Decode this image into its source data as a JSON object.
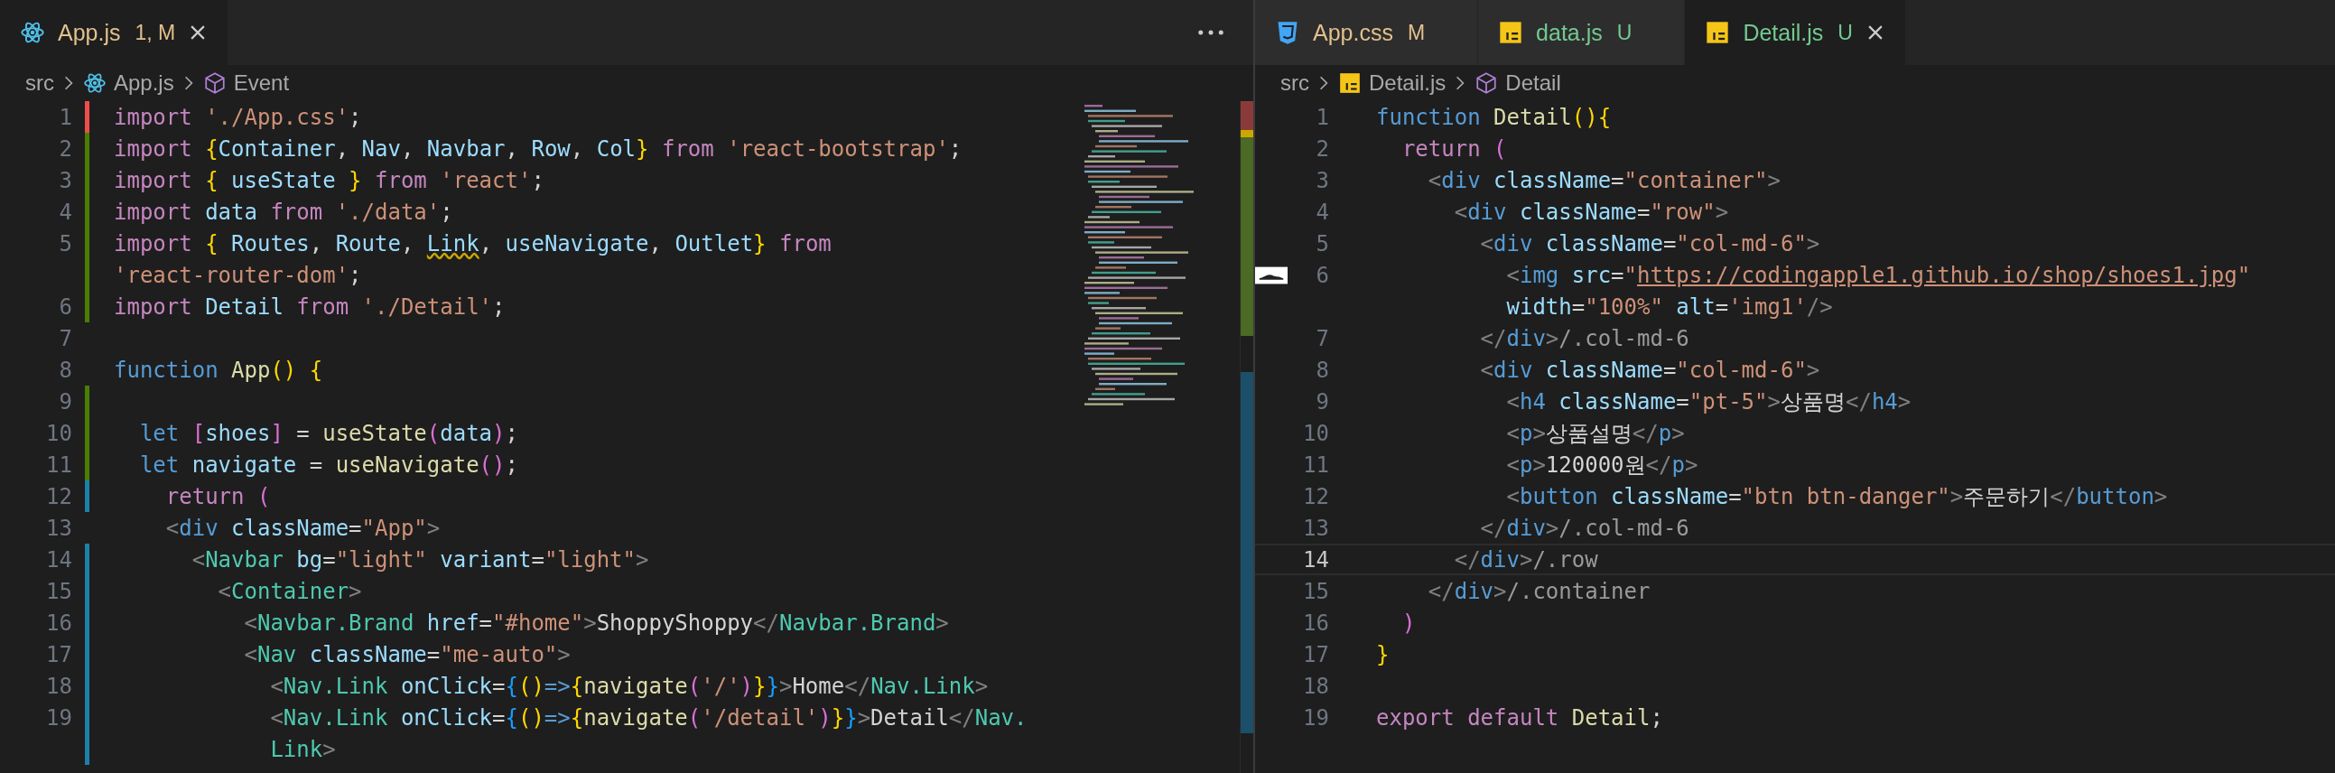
{
  "panes": [
    {
      "actions_menu": true,
      "minimap": true,
      "tabs": [
        {
          "label": "App.js",
          "badge": "1, M",
          "kind": "component",
          "color": "#e2c08d",
          "selected": true
        }
      ],
      "breadcrumb": [
        {
          "label": "src",
          "kind": "folder"
        },
        {
          "label": "App.js",
          "kind": "component"
        },
        {
          "label": "Event",
          "kind": "symbol"
        }
      ],
      "lines": [
        {
          "number": "1",
          "color": "#f14c4c",
          "tokens": [
            {
              "kind": "kw",
              "text": "import "
            },
            {
              "kind": "str",
              "text": "'./App.css'"
            },
            {
              "kind": "text",
              "text": ";"
            }
          ]
        },
        {
          "number": "2",
          "color": "#487e02",
          "tokens": [
            {
              "kind": "kw",
              "text": "import "
            },
            {
              "kind": "gold",
              "text": "{"
            },
            {
              "kind": "var",
              "text": "Container"
            },
            {
              "kind": "text",
              "text": ", "
            },
            {
              "kind": "var",
              "text": "Nav"
            },
            {
              "kind": "text",
              "text": ", "
            },
            {
              "kind": "var",
              "text": "Navbar"
            },
            {
              "kind": "text",
              "text": ", "
            },
            {
              "kind": "var",
              "text": "Row"
            },
            {
              "kind": "text",
              "text": ", "
            },
            {
              "kind": "var",
              "text": "Col"
            },
            {
              "kind": "gold",
              "text": "}"
            },
            {
              "kind": "kw",
              "text": " from "
            },
            {
              "kind": "str",
              "text": "'react-bootstrap'"
            },
            {
              "kind": "text",
              "text": ";"
            }
          ]
        },
        {
          "number": "3",
          "color": "#487e02",
          "tokens": [
            {
              "kind": "kw",
              "text": "import "
            },
            {
              "kind": "gold",
              "text": "{ "
            },
            {
              "kind": "var",
              "text": "useState"
            },
            {
              "kind": "gold",
              "text": " }"
            },
            {
              "kind": "kw",
              "text": " from "
            },
            {
              "kind": "str",
              "text": "'react'"
            },
            {
              "kind": "text",
              "text": ";"
            }
          ]
        },
        {
          "number": "4",
          "color": "#487e02",
          "tokens": [
            {
              "kind": "kw",
              "text": "import "
            },
            {
              "kind": "var",
              "text": "data"
            },
            {
              "kind": "kw",
              "text": " from "
            },
            {
              "kind": "str",
              "text": "'./data'"
            },
            {
              "kind": "text",
              "text": ";"
            }
          ]
        },
        {
          "number": "5",
          "color": "#487e02",
          "tokens": [
            {
              "kind": "kw",
              "text": "import "
            },
            {
              "kind": "gold",
              "text": "{ "
            },
            {
              "kind": "var",
              "text": "Routes"
            },
            {
              "kind": "text",
              "text": ", "
            },
            {
              "kind": "var",
              "text": "Route"
            },
            {
              "kind": "text",
              "text": ", "
            },
            {
              "kind": "var",
              "text": "Link",
              "warning": true
            },
            {
              "kind": "text",
              "text": ", "
            },
            {
              "kind": "var",
              "text": "useNavigate"
            },
            {
              "kind": "text",
              "text": ", "
            },
            {
              "kind": "var",
              "text": "Outlet"
            },
            {
              "kind": "gold",
              "text": "}"
            },
            {
              "kind": "kw",
              "text": " from"
            }
          ]
        },
        {
          "color": "#487e02",
          "tokens": [
            {
              "kind": "str",
              "text": "'react-router-dom'"
            },
            {
              "kind": "text",
              "text": ";"
            }
          ]
        },
        {
          "number": "6",
          "color": "#487e02",
          "tokens": [
            {
              "kind": "kw",
              "text": "import "
            },
            {
              "kind": "var",
              "text": "Detail"
            },
            {
              "kind": "kw",
              "text": " from "
            },
            {
              "kind": "str",
              "text": "'./Detail'"
            },
            {
              "kind": "text",
              "text": ";"
            }
          ]
        },
        {
          "number": "7"
        },
        {
          "number": "8",
          "tokens": [
            {
              "kind": "storage",
              "text": "function "
            },
            {
              "kind": "fn",
              "text": "App"
            },
            {
              "kind": "gold",
              "text": "() {"
            }
          ]
        },
        {
          "number": "9",
          "color": "#487e02"
        },
        {
          "number": "10",
          "color": "#487e02",
          "tokens": [
            {
              "kind": "storage",
              "text": "  let "
            },
            {
              "kind": "pink",
              "text": "["
            },
            {
              "kind": "var",
              "text": "shoes"
            },
            {
              "kind": "pink",
              "text": "]"
            },
            {
              "kind": "text",
              "text": " = "
            },
            {
              "kind": "fn",
              "text": "useState"
            },
            {
              "kind": "pink",
              "text": "("
            },
            {
              "kind": "var",
              "text": "data"
            },
            {
              "kind": "pink",
              "text": ")"
            },
            {
              "kind": "text",
              "text": ";"
            }
          ]
        },
        {
          "number": "11",
          "color": "#487e02",
          "tokens": [
            {
              "kind": "storage",
              "text": "  let "
            },
            {
              "kind": "var",
              "text": "navigate"
            },
            {
              "kind": "text",
              "text": " = "
            },
            {
              "kind": "fn",
              "text": "useNavigate"
            },
            {
              "kind": "pink",
              "text": "()"
            },
            {
              "kind": "text",
              "text": ";"
            }
          ]
        },
        {
          "number": "12",
          "color": "#1b81a8",
          "tokens": [
            {
              "kind": "kw",
              "text": "    return "
            },
            {
              "kind": "pink",
              "text": "("
            }
          ]
        },
        {
          "number": "13",
          "tokens": [
            {
              "kind": "angle",
              "text": "    <"
            },
            {
              "kind": "tag",
              "text": "div"
            },
            {
              "kind": "var",
              "text": " className"
            },
            {
              "kind": "text",
              "text": "="
            },
            {
              "kind": "str",
              "text": "\"App\""
            },
            {
              "kind": "angle",
              "text": ">"
            }
          ]
        },
        {
          "number": "14",
          "color": "#1b81a8",
          "tokens": [
            {
              "kind": "angle",
              "text": "      <"
            },
            {
              "kind": "comp",
              "text": "Navbar"
            },
            {
              "kind": "var",
              "text": " bg"
            },
            {
              "kind": "text",
              "text": "="
            },
            {
              "kind": "str",
              "text": "\"light\""
            },
            {
              "kind": "var",
              "text": " variant"
            },
            {
              "kind": "text",
              "text": "="
            },
            {
              "kind": "str",
              "text": "\"light\""
            },
            {
              "kind": "angle",
              "text": ">"
            }
          ]
        },
        {
          "number": "15",
          "color": "#1b81a8",
          "tokens": [
            {
              "kind": "angle",
              "text": "        <"
            },
            {
              "kind": "comp",
              "text": "Container"
            },
            {
              "kind": "angle",
              "text": ">"
            }
          ]
        },
        {
          "number": "16",
          "color": "#1b81a8",
          "tokens": [
            {
              "kind": "angle",
              "text": "          <"
            },
            {
              "kind": "comp",
              "text": "Navbar.Brand"
            },
            {
              "kind": "var",
              "text": " href"
            },
            {
              "kind": "text",
              "text": "="
            },
            {
              "kind": "str",
              "text": "\"#home\""
            },
            {
              "kind": "angle",
              "text": ">"
            },
            {
              "kind": "text",
              "text": "ShoppyShoppy"
            },
            {
              "kind": "angle",
              "text": "</"
            },
            {
              "kind": "comp",
              "text": "Navbar.Brand"
            },
            {
              "kind": "angle",
              "text": ">"
            }
          ]
        },
        {
          "number": "17",
          "color": "#1b81a8",
          "tokens": [
            {
              "kind": "angle",
              "text": "          <"
            },
            {
              "kind": "comp",
              "text": "Nav"
            },
            {
              "kind": "var",
              "text": " className"
            },
            {
              "kind": "text",
              "text": "="
            },
            {
              "kind": "str",
              "text": "\"me-auto\""
            },
            {
              "kind": "angle",
              "text": ">"
            }
          ]
        },
        {
          "number": "18",
          "color": "#1b81a8",
          "tokens": [
            {
              "kind": "angle",
              "text": "            <"
            },
            {
              "kind": "comp",
              "text": "Nav.Link"
            },
            {
              "kind": "var",
              "text": " onClick"
            },
            {
              "kind": "text",
              "text": "="
            },
            {
              "kind": "blue",
              "text": "{"
            },
            {
              "kind": "gold",
              "text": "()"
            },
            {
              "kind": "storage",
              "text": "=>"
            },
            {
              "kind": "gold",
              "text": "{"
            },
            {
              "kind": "fn",
              "text": "navigate"
            },
            {
              "kind": "pink",
              "text": "("
            },
            {
              "kind": "str",
              "text": "'/'"
            },
            {
              "kind": "pink",
              "text": ")"
            },
            {
              "kind": "gold",
              "text": "}"
            },
            {
              "kind": "blue",
              "text": "}"
            },
            {
              "kind": "angle",
              "text": ">"
            },
            {
              "kind": "text",
              "text": "Home"
            },
            {
              "kind": "angle",
              "text": "</"
            },
            {
              "kind": "comp",
              "text": "Nav.Link"
            },
            {
              "kind": "angle",
              "text": ">"
            }
          ]
        },
        {
          "number": "19",
          "color": "#1b81a8",
          "tokens": [
            {
              "kind": "angle",
              "text": "            <"
            },
            {
              "kind": "comp",
              "text": "Nav.Link"
            },
            {
              "kind": "var",
              "text": " onClick"
            },
            {
              "kind": "text",
              "text": "="
            },
            {
              "kind": "blue",
              "text": "{"
            },
            {
              "kind": "gold",
              "text": "()"
            },
            {
              "kind": "storage",
              "text": "=>"
            },
            {
              "kind": "gold",
              "text": "{"
            },
            {
              "kind": "fn",
              "text": "navigate"
            },
            {
              "kind": "pink",
              "text": "("
            },
            {
              "kind": "str",
              "text": "'/detail'"
            },
            {
              "kind": "pink",
              "text": ")"
            },
            {
              "kind": "gold",
              "text": "}"
            },
            {
              "kind": "blue",
              "text": "}"
            },
            {
              "kind": "angle",
              "text": ">"
            },
            {
              "kind": "text",
              "text": "Detail"
            },
            {
              "kind": "angle",
              "text": "</"
            },
            {
              "kind": "comp",
              "text": "Nav."
            }
          ]
        },
        {
          "color": "#1b81a8",
          "tokens": [
            {
              "kind": "comp",
              "text": "            Link"
            },
            {
              "kind": "angle",
              "text": ">"
            }
          ]
        }
      ]
    },
    {
      "tabs": [
        {
          "label": "App.css",
          "badge": "M",
          "kind": "stylesheet",
          "color": "#e2c08d",
          "selected": false
        },
        {
          "label": "data.js",
          "badge": "U",
          "kind": "script",
          "color": "#73c991",
          "selected": false
        },
        {
          "label": "Detail.js",
          "badge": "U",
          "kind": "script",
          "color": "#73c991",
          "selected": true
        }
      ],
      "breadcrumb": [
        {
          "label": "src",
          "kind": "folder"
        },
        {
          "label": "Detail.js",
          "kind": "script"
        },
        {
          "label": "Detail",
          "kind": "symbol"
        }
      ],
      "lines": [
        {
          "number": "1",
          "tokens": [
            {
              "kind": "storage",
              "text": "function "
            },
            {
              "kind": "fn",
              "text": "Detail"
            },
            {
              "kind": "gold",
              "text": "(){"
            }
          ]
        },
        {
          "number": "2",
          "tokens": [
            {
              "kind": "kw",
              "text": "  return "
            },
            {
              "kind": "pink",
              "text": "("
            }
          ]
        },
        {
          "number": "3",
          "tokens": [
            {
              "kind": "angle",
              "text": "    <"
            },
            {
              "kind": "tag",
              "text": "div"
            },
            {
              "kind": "var",
              "text": " className"
            },
            {
              "kind": "text",
              "text": "="
            },
            {
              "kind": "str",
              "text": "\"container\""
            },
            {
              "kind": "angle",
              "text": ">"
            }
          ]
        },
        {
          "number": "4",
          "tokens": [
            {
              "kind": "angle",
              "text": "      <"
            },
            {
              "kind": "tag",
              "text": "div"
            },
            {
              "kind": "var",
              "text": " className"
            },
            {
              "kind": "text",
              "text": "="
            },
            {
              "kind": "str",
              "text": "\"row\""
            },
            {
              "kind": "angle",
              "text": ">"
            }
          ]
        },
        {
          "number": "5",
          "tokens": [
            {
              "kind": "angle",
              "text": "        <"
            },
            {
              "kind": "tag",
              "text": "div"
            },
            {
              "kind": "var",
              "text": " className"
            },
            {
              "kind": "text",
              "text": "="
            },
            {
              "kind": "str",
              "text": "\"col-md-6\""
            },
            {
              "kind": "angle",
              "text": ">"
            }
          ]
        },
        {
          "number": "6",
          "preview": true,
          "tokens": [
            {
              "kind": "angle",
              "text": "          <"
            },
            {
              "kind": "tag",
              "text": "img"
            },
            {
              "kind": "var",
              "text": " src"
            },
            {
              "kind": "text",
              "text": "="
            },
            {
              "kind": "str",
              "text": "\""
            },
            {
              "kind": "url",
              "text": "https://codingapple1.github.io/shop/shoes1.jpg"
            },
            {
              "kind": "str",
              "text": "\""
            }
          ]
        },
        {
          "tokens": [
            {
              "kind": "var",
              "text": "          width"
            },
            {
              "kind": "text",
              "text": "="
            },
            {
              "kind": "str",
              "text": "\"100%\""
            },
            {
              "kind": "var",
              "text": " alt"
            },
            {
              "kind": "text",
              "text": "="
            },
            {
              "kind": "str",
              "text": "'img1'"
            },
            {
              "kind": "angle",
              "text": "/>"
            }
          ]
        },
        {
          "number": "7",
          "tokens": [
            {
              "kind": "angle",
              "text": "        </"
            },
            {
              "kind": "tag",
              "text": "div"
            },
            {
              "kind": "angle",
              "text": ">"
            },
            {
              "kind": "hint",
              "text": "/.col-md-6"
            }
          ]
        },
        {
          "number": "8",
          "tokens": [
            {
              "kind": "angle",
              "text": "        <"
            },
            {
              "kind": "tag",
              "text": "div"
            },
            {
              "kind": "var",
              "text": " className"
            },
            {
              "kind": "text",
              "text": "="
            },
            {
              "kind": "str",
              "text": "\"col-md-6\""
            },
            {
              "kind": "angle",
              "text": ">"
            }
          ]
        },
        {
          "number": "9",
          "tokens": [
            {
              "kind": "angle",
              "text": "          <"
            },
            {
              "kind": "tag",
              "text": "h4"
            },
            {
              "kind": "var",
              "text": " className"
            },
            {
              "kind": "text",
              "text": "="
            },
            {
              "kind": "str",
              "text": "\"pt-5\""
            },
            {
              "kind": "angle",
              "text": ">"
            },
            {
              "kind": "text",
              "text": "상품명"
            },
            {
              "kind": "angle",
              "text": "</"
            },
            {
              "kind": "tag",
              "text": "h4"
            },
            {
              "kind": "angle",
              "text": ">"
            }
          ]
        },
        {
          "number": "10",
          "tokens": [
            {
              "kind": "angle",
              "text": "          <"
            },
            {
              "kind": "tag",
              "text": "p"
            },
            {
              "kind": "angle",
              "text": ">"
            },
            {
              "kind": "text",
              "text": "상품설명"
            },
            {
              "kind": "angle",
              "text": "</"
            },
            {
              "kind": "tag",
              "text": "p"
            },
            {
              "kind": "angle",
              "text": ">"
            }
          ]
        },
        {
          "number": "11",
          "tokens": [
            {
              "kind": "angle",
              "text": "          <"
            },
            {
              "kind": "tag",
              "text": "p"
            },
            {
              "kind": "angle",
              "text": ">"
            },
            {
              "kind": "text",
              "text": "120000원"
            },
            {
              "kind": "angle",
              "text": "</"
            },
            {
              "kind": "tag",
              "text": "p"
            },
            {
              "kind": "angle",
              "text": ">"
            }
          ]
        },
        {
          "number": "12",
          "tokens": [
            {
              "kind": "angle",
              "text": "          <"
            },
            {
              "kind": "tag",
              "text": "button"
            },
            {
              "kind": "var",
              "text": " className"
            },
            {
              "kind": "text",
              "text": "="
            },
            {
              "kind": "str",
              "text": "\"btn btn-danger\""
            },
            {
              "kind": "angle",
              "text": ">"
            },
            {
              "kind": "text",
              "text": "주문하기"
            },
            {
              "kind": "angle",
              "text": "</"
            },
            {
              "kind": "tag",
              "text": "button"
            },
            {
              "kind": "angle",
              "text": ">"
            }
          ]
        },
        {
          "number": "13",
          "tokens": [
            {
              "kind": "angle",
              "text": "        </"
            },
            {
              "kind": "tag",
              "text": "div"
            },
            {
              "kind": "angle",
              "text": ">"
            },
            {
              "kind": "hint",
              "text": "/.col-md-6"
            }
          ]
        },
        {
          "number": "14",
          "current": true,
          "tokens": [
            {
              "kind": "angle",
              "text": "      </"
            },
            {
              "kind": "tag",
              "text": "div"
            },
            {
              "kind": "angle",
              "text": ">"
            },
            {
              "kind": "hint",
              "text": "/.row"
            }
          ]
        },
        {
          "number": "15",
          "tokens": [
            {
              "kind": "angle",
              "text": "    </"
            },
            {
              "kind": "tag",
              "text": "div"
            },
            {
              "kind": "angle",
              "text": ">"
            },
            {
              "kind": "hint",
              "text": "/.container"
            }
          ]
        },
        {
          "number": "16",
          "tokens": [
            {
              "kind": "pink",
              "text": "  )"
            }
          ]
        },
        {
          "number": "17",
          "tokens": [
            {
              "kind": "gold",
              "text": "}"
            }
          ]
        },
        {
          "number": "18"
        },
        {
          "number": "19",
          "tokens": [
            {
              "kind": "kw",
              "text": "export default "
            },
            {
              "kind": "fn",
              "text": "Detail"
            },
            {
              "kind": "text",
              "text": ";"
            }
          ]
        }
      ]
    }
  ]
}
